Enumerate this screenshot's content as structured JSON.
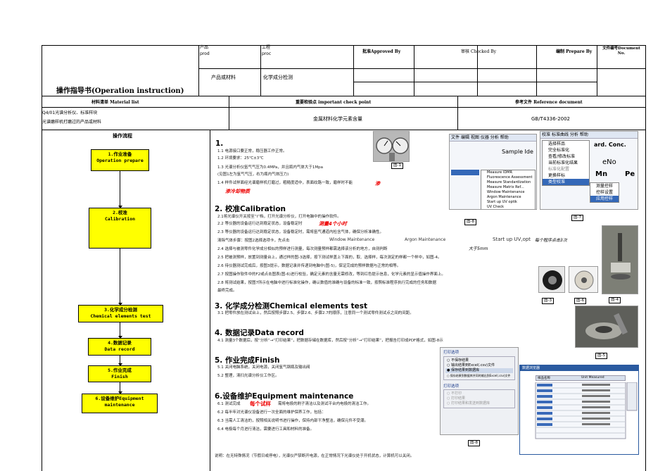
{
  "header": {
    "title": "操作指导书(Operation  instruction)",
    "prod_cn": "产品",
    "prod_en": "prod",
    "proc_cn": "工程",
    "proc_en": "proc",
    "product_value": "产品或材料",
    "process_value": "化学成分检测",
    "approved_by": "批准Approved By",
    "checked_by": "审核 Checked By",
    "prepare_by": "编制 Prepare By",
    "doc_no": "文件编号Document No."
  },
  "subheader": {
    "material_list": "材料清单 Material list",
    "important_points": "重要检验点 important check point",
    "reference_doc": "参考文件 Reference document",
    "material_line1": "Q4/01光谱分析仪、标准样块",
    "material_line2": "光谱磨样机打磨过的产品或材料",
    "check_point_value": "金属材料化学元素含量",
    "reference_value": "GB/T4336-2002"
  },
  "flow": {
    "title": "操作流程",
    "boxes": [
      {
        "cn": "1.作业准备",
        "en": "Operation prepare"
      },
      {
        "cn": "2.校准",
        "en": "Calibration"
      },
      {
        "cn": "3.化学成分检测",
        "en": "Chemical elements test"
      },
      {
        "cn": "4.数据记录",
        "en": "Data record"
      },
      {
        "cn": "5.作业完成",
        "en": "Finish"
      },
      {
        "cn": "6.设备维护Equipment",
        "en": "maintenance"
      }
    ]
  },
  "sections": {
    "s1_title": "1.",
    "s1_lines": [
      "1.1  电源接口要正常，稳压器工作正常。",
      "1.2  环境要求：25℃±3℃",
      "1.3  光谱分析仪氩气气压为0.4MPa，并且瓶内气体大于1Mpa",
      "      (见图1左为氩气气压，右为瓶内气体压力)",
      "1.4  样件试样面经光谱磨样机打磨过，粗糙度适中，表面纹路一致，磨样时不能"
    ],
    "s1_red": "渗冷却物质",
    "s1_red_tail": "渗",
    "s2_title": "2. 校准Calibration",
    "s2_lines": [
      "2.1将光谱仪开关按至“I”档，打开光谱分析仪，打开电脑中的操作软件。",
      "2.2  等仪器的设备运行达到稳定状态，设备稳定时",
      "2.3  等仪器的设备运行达到稳定状态，设备稳定时，需将氩气通道内检含气体，确保分析准确性。",
      "     清除气体步骤：按图2选择选项卡，先点击",
      "2.4  选择与被测零件化学成分相似的预样进行测量，每次测量预样都需选择该分析的地方，自测判断",
      "2.5  把被测预样，放置到测量台上，通过样的图-3选择，按下测试样盖上下面的，取、选择样，每次测定的样都一个样中，如图-4。",
      "2.6  待仪器测试完成后，按图3提示，数据记录并传递到电脑中(图-5)，保证完成的预样数据与正常的相等。",
      "2.7  按图操作软件中的F2或点击图表(图-6)进行校验，确定元素的含量无需修改，等到红色提示信息，化学元素的显示值操作界面上。",
      "2.8  将测试结果，按图7所示在电脑中进行标准化操作，确认数值的准确与设备的标准一致，按照标准程序执行完成的任务和数据",
      "     最终完成。"
    ],
    "s2_red": "测量4个小时",
    "s2_mid1": "Window Maintenance",
    "s2_mid2": "Argon Maintenance",
    "s2_mid3": "Start up UV,opt",
    "s2_mid4": "每个程序点击3次",
    "s2_big": "大于5mm",
    "s3_title": "3. 化学成分检测Chemical  elements  test",
    "s3_line": "3.1  把零件放在测试台上，然后按照步骤2.5、步骤2.6、步骤2.7的顺序，注意同一个测试零件测试点之间的间距。",
    "s4_title": "4. 数据记录Data  record",
    "s4_line": "4.1  测量3个数据后，按“分析”→“打印结果”，把数据存储在数据库，然后按“分析”→“打印结果”，把报告打印成PDF格式，如图-8示",
    "s5_title": "5. 作业完成Finish",
    "s5_lines": [
      "5.1  关闭电脑系统，关闭电源，关闭氩气钢瓶及输出阀",
      "5.2  整理，清扫光谱分析仪工作区。"
    ],
    "s6_title": "6.设备维护Equipment  maintenance",
    "s6_lines": [
      "6.1  测试完成",
      "6.2  每半年对光谱仪设备进行一次全面的维护保养工作，包括：",
      "6.3  当需人工清洁的，按照相关说明书进行操作，保持内部干净整洁，确保元件不受潮。",
      "6.4  电极每个月进行清洁，需要进行工具和材料的准备。"
    ],
    "s6_red": "每个试样",
    "s6_line1_tail": "需将电极的刷子清洁以及测试平台内电极的清洁工作。",
    "footnote": "说明：在无特殊情况（节假日或停电），光谱仪严禁断开电源，在正常情况下光谱仪处于开机状态，计算机可以关闭。"
  },
  "figures": {
    "fig1": "图-1",
    "fig2": "图-2",
    "fig3": "图-3",
    "fig4": "图-4",
    "fig5": "图-5",
    "fig6": "图-6",
    "fig7": "图-7",
    "fig8": "图-8",
    "screen2_title": "Sample Ide",
    "screen2_menu": [
      "文件",
      "编辑",
      "视图",
      "仪器",
      "分析",
      "帮助"
    ],
    "screen2_items": [
      "Measure IDMR",
      "Fluorescence Assessment",
      "Measure Standardization",
      "Measure Matrix Ref...",
      "Window Maintenance",
      "Argon Maintenance",
      "Start up UV optik",
      "UV Check"
    ],
    "screen7_menu": [
      "校准",
      "标准曲线",
      "分析",
      "帮助"
    ],
    "screen7_items": [
      "选择样品",
      "完全标准化",
      "查看/修改标准",
      "当前标准化结果",
      "标准化配置",
      "更换样标",
      "类型校准"
    ],
    "screen7_sub": [
      "测量控样",
      "控样设置",
      "应用控样"
    ],
    "screen7_right": [
      "ard. Conc.",
      "eNo",
      "Mn",
      "Pe"
    ],
    "dialog8_title": "打印选项",
    "dialog8_options": [
      "不保存结果",
      "输出结果到Excel(.csv)文件",
      "保存结果到数据库",
      "保存结果到数据库并同时输出到Excel(.csv)文件"
    ],
    "dialog8_sub_title": "打印选项",
    "dialog8_sub_options": [
      "不打印",
      "打印结果",
      "打印结果和发送到数据库"
    ],
    "table8_title": "数据浏览器",
    "table8_headers": [
      "样品名称",
      "Unit Measured"
    ]
  },
  "colors": {
    "flow_box": "#ffff00",
    "red_text": "#ee0000",
    "screen_bg": "#dfe7f3"
  }
}
